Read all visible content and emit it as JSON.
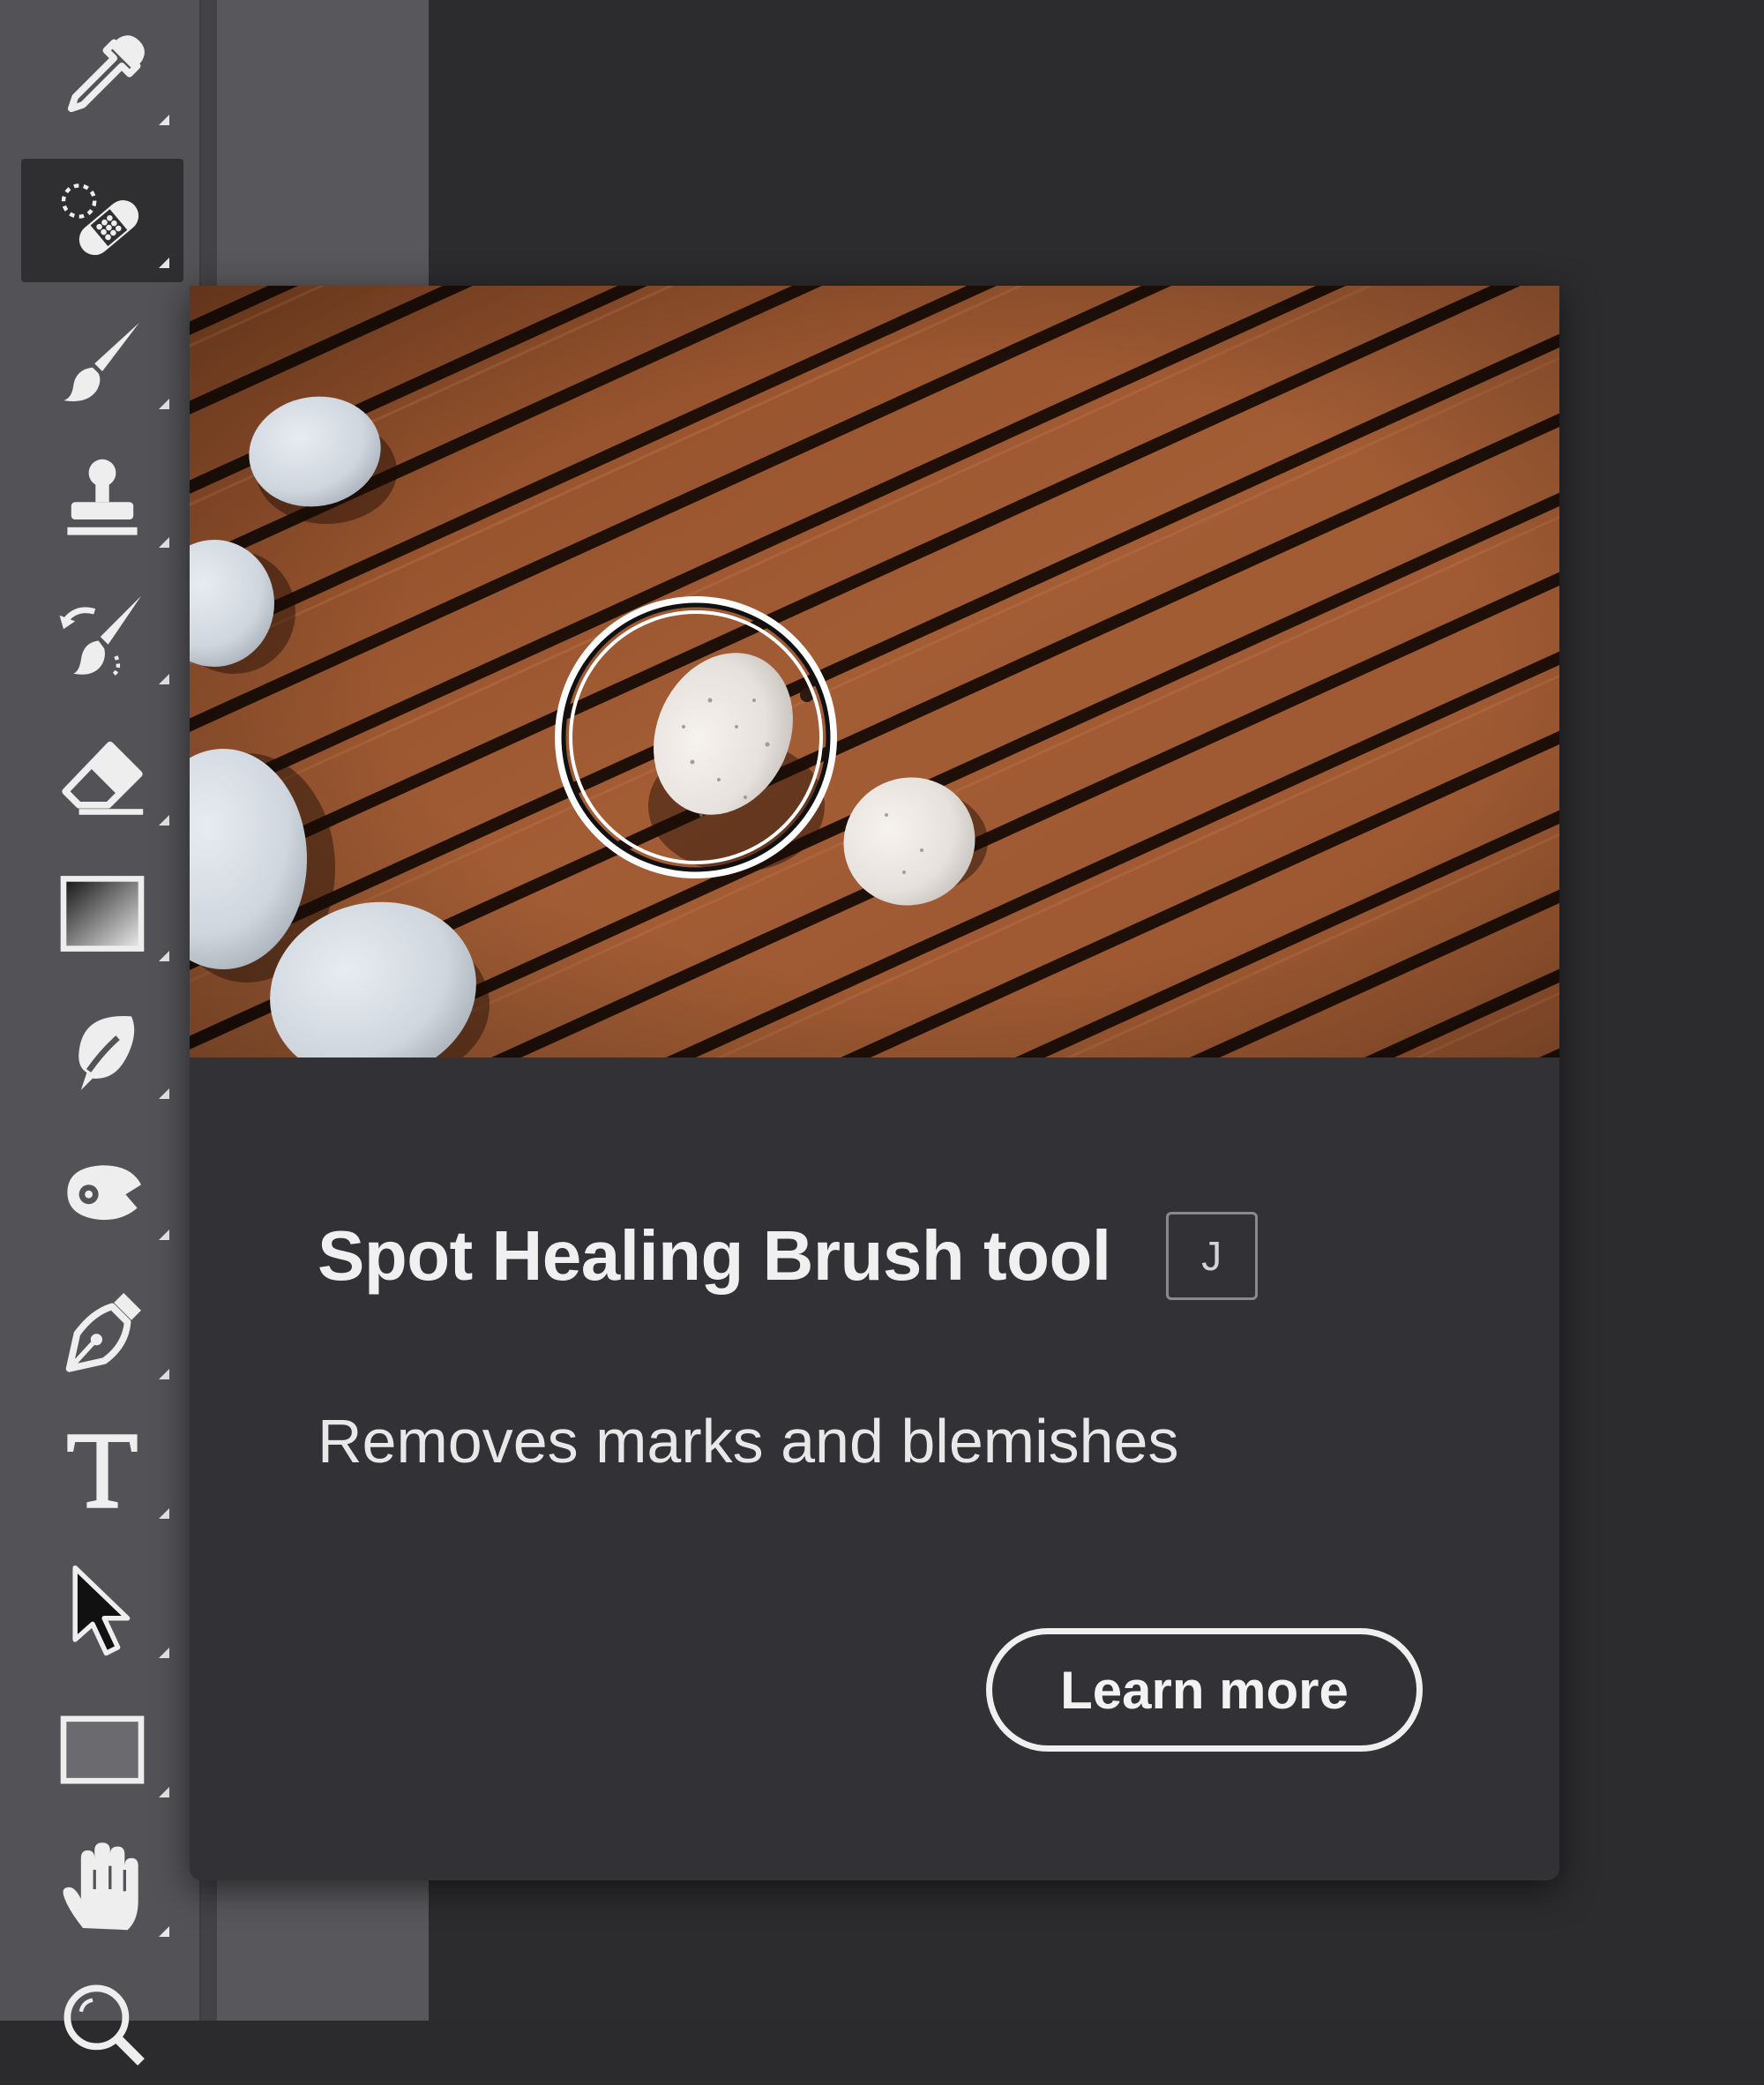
{
  "toolbar": {
    "tools": [
      {
        "name": "eyedropper-tool",
        "icon": "eyedropper-icon",
        "selected": false
      },
      {
        "name": "spot-healing-brush-tool",
        "icon": "bandage-icon",
        "selected": true
      },
      {
        "name": "brush-tool",
        "icon": "brush-icon",
        "selected": false
      },
      {
        "name": "clone-stamp-tool",
        "icon": "stamp-icon",
        "selected": false
      },
      {
        "name": "history-brush-tool",
        "icon": "history-brush-icon",
        "selected": false
      },
      {
        "name": "eraser-tool",
        "icon": "eraser-icon",
        "selected": false
      },
      {
        "name": "gradient-tool",
        "icon": "gradient-icon",
        "selected": false
      },
      {
        "name": "blur-tool",
        "icon": "drop-icon",
        "selected": false
      },
      {
        "name": "dodge-tool",
        "icon": "dodge-icon",
        "selected": false
      },
      {
        "name": "pen-tool",
        "icon": "pen-icon",
        "selected": false
      },
      {
        "name": "type-tool",
        "icon": "type-icon",
        "selected": false
      },
      {
        "name": "path-selection-tool",
        "icon": "arrow-icon",
        "selected": false
      },
      {
        "name": "rectangle-tool",
        "icon": "rectangle-icon",
        "selected": false
      },
      {
        "name": "hand-tool",
        "icon": "hand-icon",
        "selected": false
      },
      {
        "name": "zoom-tool",
        "icon": "zoom-icon",
        "selected": false
      }
    ]
  },
  "tooltip": {
    "title": "Spot Healing Brush tool",
    "shortcut": "J",
    "description": "Removes marks and blemishes",
    "learn_more_label": "Learn more"
  },
  "colors": {
    "toolbar_bg": "#535256",
    "card_bg": "#323135",
    "wood": "#9a5530",
    "text": "#f0f0f0"
  }
}
